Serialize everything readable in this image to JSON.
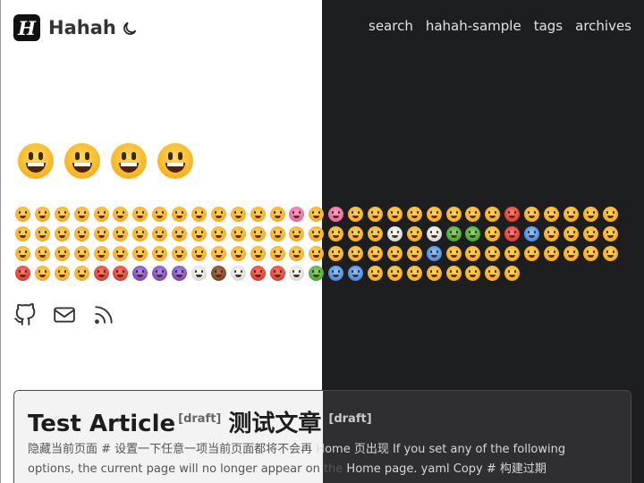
{
  "header": {
    "logo_letter": "H",
    "site_title": "Hahah",
    "theme_icon": "moon-icon",
    "nav": [
      {
        "label": "search"
      },
      {
        "label": "hahah-sample"
      },
      {
        "label": "tags"
      },
      {
        "label": "archives"
      }
    ]
  },
  "emoji_section": {
    "big_emoji_count": 4,
    "grid_colors": [
      "y",
      "y",
      "y",
      "y",
      "y",
      "y",
      "y",
      "y",
      "y",
      "y",
      "y",
      "y",
      "y",
      "y",
      "pink",
      "y",
      "pink",
      "y",
      "y",
      "y",
      "y",
      "y",
      "y",
      "y",
      "y",
      "red",
      "y",
      "y",
      "y",
      "y",
      "y",
      "y",
      "y",
      "y",
      "y",
      "y",
      "y",
      "y",
      "y",
      "y",
      "y",
      "y",
      "y",
      "y",
      "y",
      "y",
      "y",
      "y",
      "y",
      "y",
      "white",
      "y",
      "white",
      "green",
      "green",
      "y",
      "red",
      "blue",
      "y",
      "y",
      "y",
      "y",
      "y",
      "y",
      "y",
      "y",
      "y",
      "y",
      "y",
      "y",
      "y",
      "y",
      "y",
      "y",
      "y",
      "y",
      "y",
      "y",
      "y",
      "y",
      "y",
      "y",
      "y",
      "blue",
      "y",
      "y",
      "y",
      "y",
      "y",
      "y",
      "y",
      "y",
      "y",
      "red",
      "y",
      "y",
      "y",
      "red",
      "red",
      "purple",
      "purple",
      "purple",
      "white",
      "brown",
      "white",
      "red",
      "red",
      "white",
      "green",
      "blue",
      "blue",
      "y",
      "y",
      "y",
      "y",
      "y",
      "y",
      "y",
      "y"
    ]
  },
  "social": {
    "icons": [
      "github-icon",
      "mail-icon",
      "rss-icon"
    ]
  },
  "post": {
    "title": "Test Article",
    "draft_label": "[draft]",
    "title_cjk": "测试文章",
    "draft_label_2": "[draft]",
    "summary_light": "隐藏当前页面 # 设置一下任意一项当前页面都将不会再",
    "summary_dark_1": " Home 页出现 If you set any of the following",
    "summary_light_2": "options, the current page will no longer appear on the",
    "summary_dark_2": " Home page. yaml Copy # 构建过期 buildExpired:"
  }
}
